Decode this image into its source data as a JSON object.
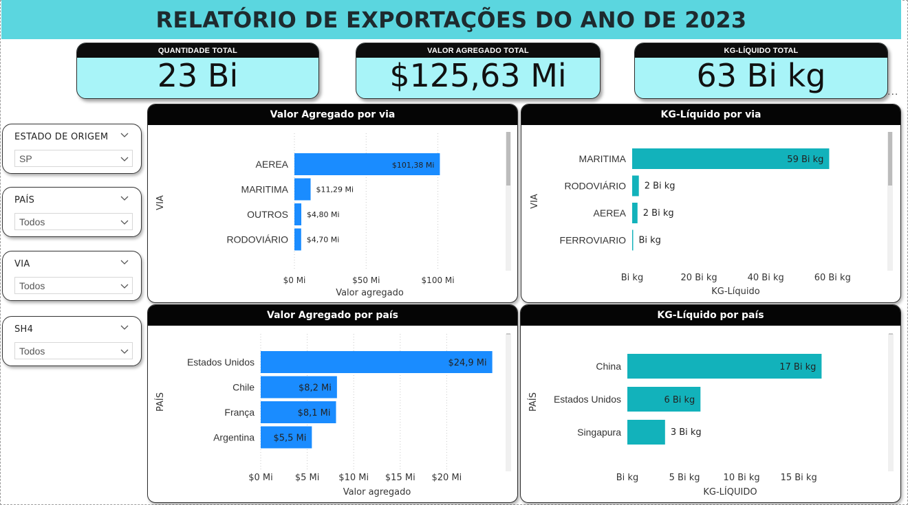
{
  "title": "RELATÓRIO DE EXPORTAÇÕES DO ANO DE 2023",
  "kpis": [
    {
      "label": "QUANTIDADE TOTAL",
      "value": "23 Bi"
    },
    {
      "label": "VALOR AGREGADO TOTAL",
      "value": "$125,63 Mi"
    },
    {
      "label": "KG-LÍQUIDO TOTAL",
      "value": "63 Bi kg"
    }
  ],
  "more_options": "...",
  "slicers": [
    {
      "label": "ESTADO DE ORIGEM",
      "value": "SP"
    },
    {
      "label": "PAÍS",
      "value": "Todos"
    },
    {
      "label": "VIA",
      "value": "Todos"
    },
    {
      "label": "SH4",
      "value": "Todos"
    }
  ],
  "colors": {
    "blue_bar": "#1a8cff",
    "teal_bar": "#12b2bb",
    "title_bg": "#5bd6df",
    "kpi_bg": "#a8f4f8"
  },
  "chart_data": [
    {
      "type": "bar",
      "orientation": "horizontal",
      "title": "Valor Agregado por via",
      "categories": [
        "AEREA",
        "MARITIMA",
        "OUTROS",
        "RODOVIÁRIO"
      ],
      "values": [
        101.38,
        11.29,
        4.8,
        4.7
      ],
      "data_labels": [
        "$101,38 Mi",
        "$11,29 Mi",
        "$4,80 Mi",
        "$4,70 Mi"
      ],
      "xlabel": "Valor agregado",
      "ylabel": "VIA",
      "xticks": [
        0,
        50,
        100
      ],
      "xtick_labels": [
        "$0 Mi",
        "$50 Mi",
        "$100 Mi"
      ],
      "xlim": [
        0,
        105
      ],
      "grid": true,
      "color": "#1a8cff"
    },
    {
      "type": "bar",
      "orientation": "horizontal",
      "title": "KG-Líquido por via",
      "categories": [
        "MARITIMA",
        "RODOVIÁRIO",
        "AEREA",
        "FERROVIARIO"
      ],
      "values": [
        59,
        2,
        1.6,
        0.3
      ],
      "data_labels": [
        "59 Bi kg",
        "2 Bi kg",
        "2 Bi kg",
        "Bi kg"
      ],
      "xlabel": "KG-Líquido",
      "ylabel": "VIA",
      "xticks": [
        0,
        20,
        40,
        60
      ],
      "xtick_labels": [
        "Bi kg",
        "20 Bi kg",
        "40 Bi kg",
        "60 Bi kg"
      ],
      "xlim": [
        0,
        62
      ],
      "grid": false,
      "color": "#12b2bb"
    },
    {
      "type": "bar",
      "orientation": "horizontal",
      "title": "Valor Agregado por país",
      "categories": [
        "Estados Unidos",
        "Chile",
        "França",
        "Argentina"
      ],
      "values": [
        24.9,
        8.2,
        8.1,
        5.5
      ],
      "data_labels": [
        "$24,9 Mi",
        "$8,2 Mi",
        "$8,1 Mi",
        "$5,5 Mi"
      ],
      "xlabel": "Valor agregado",
      "ylabel": "PAÍS",
      "xticks": [
        0,
        5,
        10,
        15,
        20
      ],
      "xtick_labels": [
        "$0 Mi",
        "$5 Mi",
        "$10 Mi",
        "$15 Mi",
        "$20 Mi"
      ],
      "xlim": [
        0,
        25
      ],
      "grid": true,
      "color": "#1a8cff"
    },
    {
      "type": "bar",
      "orientation": "horizontal",
      "title": "KG-Líquido por país",
      "categories": [
        "China",
        "Estados Unidos",
        "Singapura"
      ],
      "values": [
        17,
        6.4,
        3.3
      ],
      "data_labels": [
        "17 Bi kg",
        "6 Bi kg",
        "3 Bi kg"
      ],
      "xlabel": "KG-LÍQUIDO",
      "ylabel": "PAÍS",
      "xticks": [
        0,
        5,
        10,
        15
      ],
      "xtick_labels": [
        "Bi kg",
        "5 Bi kg",
        "10 Bi kg",
        "15 Bi kg"
      ],
      "xlim": [
        0,
        18
      ],
      "grid": false,
      "color": "#12b2bb"
    }
  ]
}
